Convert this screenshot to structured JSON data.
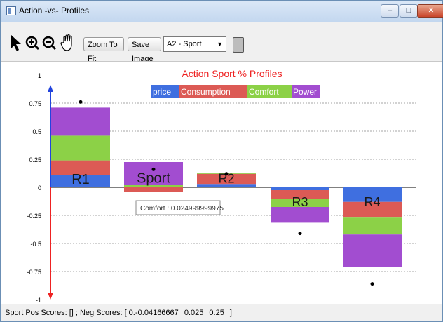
{
  "window": {
    "title": "Action -vs- Profiles"
  },
  "toolbar": {
    "zoom_fit_label": "Zoom To Fit",
    "save_image_label": "Save Image",
    "profile_selected": "A2 - Sport"
  },
  "chart_data": {
    "type": "bar",
    "title": "Action Sport  % Profiles",
    "legend": [
      "price",
      "Consumption",
      "Comfort",
      "Power"
    ],
    "colors": {
      "price": "#3f6fe0",
      "Consumption": "#dc5a55",
      "Comfort": "#8cd147",
      "Power": "#a24dd0"
    },
    "ylim": [
      -1,
      1
    ],
    "yticks": [
      "1",
      "0.75",
      "0.5",
      "0.25",
      "0",
      "-0.25",
      "-0.5",
      "-0.75",
      "-1"
    ],
    "categories": [
      "R1",
      "Sport",
      "R2",
      "R3",
      "R4"
    ],
    "series": [
      {
        "name": "price",
        "values": [
          0.11,
          0,
          0.03,
          -0.025,
          -0.13
        ]
      },
      {
        "name": "Consumption",
        "values": [
          0.13,
          -0.042,
          0.09,
          -0.08,
          -0.14
        ]
      },
      {
        "name": "Comfort",
        "values": [
          0.22,
          0.025,
          0.01,
          -0.07,
          -0.15
        ]
      },
      {
        "name": "Power",
        "values": [
          0.25,
          0.2,
          0,
          -0.14,
          -0.29
        ]
      }
    ],
    "markers": [
      0.76,
      0.16,
      0.12,
      -0.41,
      -0.86
    ],
    "tooltip": "Comfort : 0.024999999975"
  },
  "status": {
    "prefix": "Sport  Pos Scores: [] ; Neg Scores: [ 0.",
    "values": "-0.04166667 0.025 0.25 ]"
  }
}
